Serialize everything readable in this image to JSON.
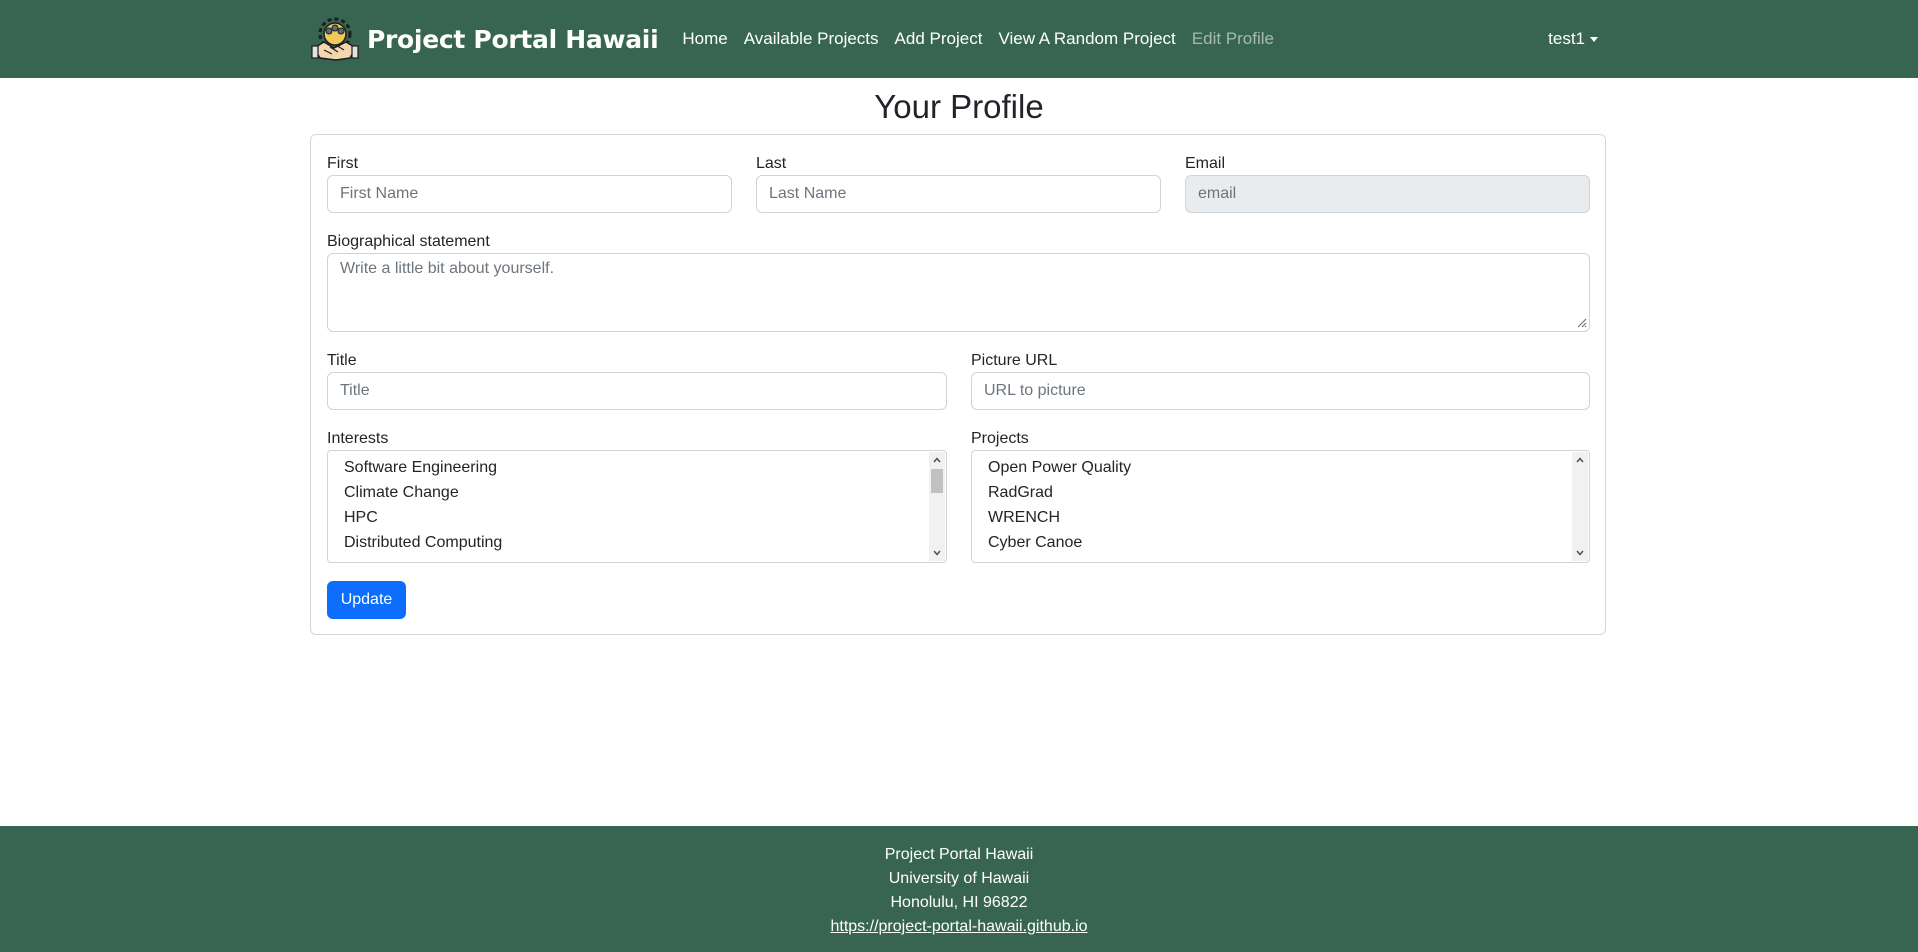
{
  "nav": {
    "brand": "Project Portal Hawaii",
    "links": [
      {
        "label": "Home"
      },
      {
        "label": "Available Projects"
      },
      {
        "label": "Add Project"
      },
      {
        "label": "View A Random Project"
      },
      {
        "label": "Edit Profile",
        "active": true
      }
    ],
    "user": "test1"
  },
  "page": {
    "title": "Your Profile"
  },
  "form": {
    "first": {
      "label": "First",
      "placeholder": "First Name",
      "value": ""
    },
    "last": {
      "label": "Last",
      "placeholder": "Last Name",
      "value": ""
    },
    "email": {
      "label": "Email",
      "placeholder": "email",
      "value": ""
    },
    "bio": {
      "label": "Biographical statement",
      "placeholder": "Write a little bit about yourself.",
      "value": ""
    },
    "title": {
      "label": "Title",
      "placeholder": "Title",
      "value": ""
    },
    "picture": {
      "label": "Picture URL",
      "placeholder": "URL to picture",
      "value": ""
    },
    "interests": {
      "label": "Interests",
      "options": [
        "Software Engineering",
        "Climate Change",
        "HPC",
        "Distributed Computing"
      ]
    },
    "projects": {
      "label": "Projects",
      "options": [
        "Open Power Quality",
        "RadGrad",
        "WRENCH",
        "Cyber Canoe"
      ]
    },
    "submit_label": "Update"
  },
  "footer": {
    "line1": "Project Portal Hawaii",
    "line2": "University of Hawaii",
    "line3": "Honolulu, HI 96822",
    "link": "https://project-portal-hawaii.github.io"
  },
  "colors": {
    "navbar": "#376551",
    "primary_button": "#0d6efd"
  }
}
